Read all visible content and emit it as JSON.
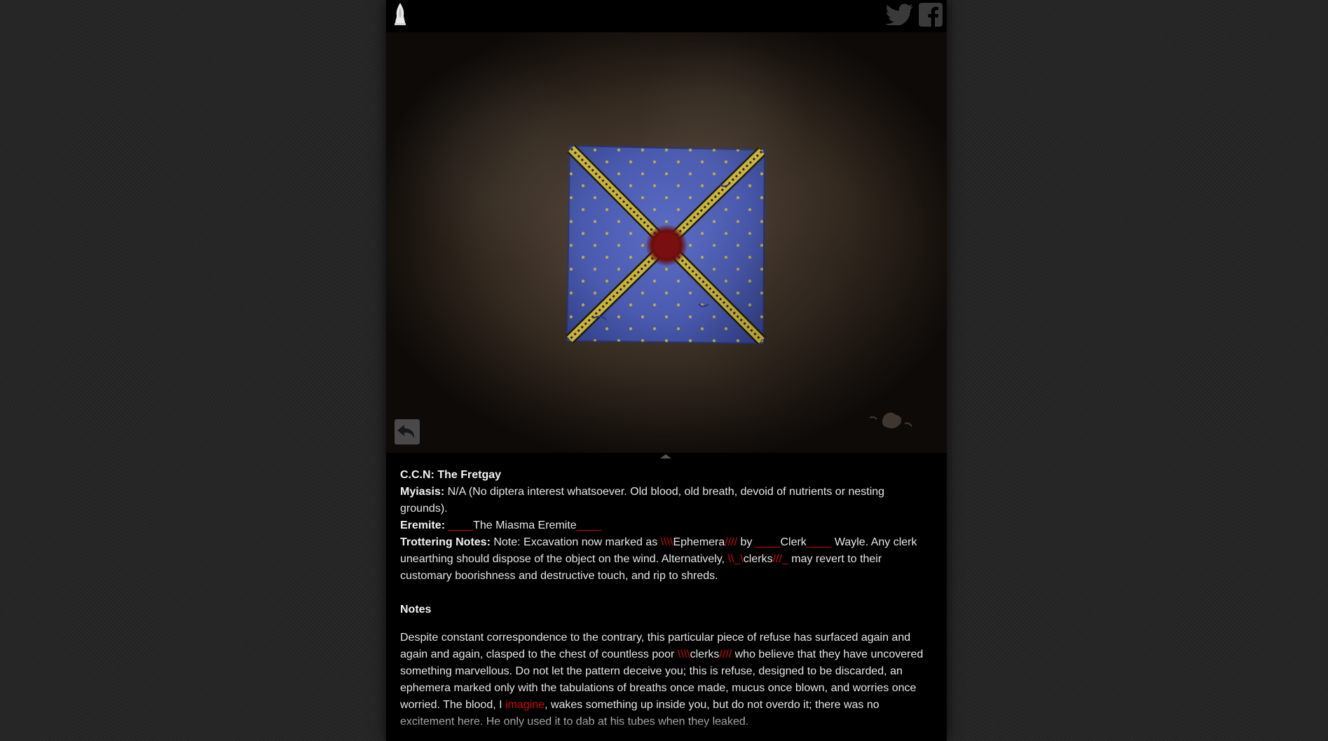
{
  "header": {
    "logo_icon": "candle-flame-icon",
    "social": [
      {
        "name": "twitter",
        "icon": "twitter-bird-icon"
      },
      {
        "name": "facebook",
        "icon": "facebook-f-icon"
      }
    ]
  },
  "viewer": {
    "artifact_icon": "blue-handkerchief-image",
    "back_icon": "undo-arrow-icon",
    "handle_icon": "collapse-caret-icon"
  },
  "entry": {
    "ccn_label": "C.C.N:",
    "ccn_value": "The Fretgay",
    "myiasis_label": "Myiasis:",
    "myiasis_value": " N/A (No diptera interest whatsoever. Old blood, old breath, devoid of nutrients or nesting grounds).",
    "eremite_label": "Eremite:",
    "eremite_pre": " ____",
    "eremite_value": "The Miasma Eremite",
    "eremite_post": "____",
    "trottering_label": "Trottering Notes:",
    "tn_1": " Note: Excavation now marked as ",
    "tn_red_1": "\\\\\\\\",
    "tn_2": "Ephemera",
    "tn_red_2": "////",
    "tn_3": " by ",
    "tn_red_3": "____",
    "tn_4": "Clerk",
    "tn_red_4": "____",
    "tn_5": " Wayle. Any clerk unearthing should dispose of the object on the wind. Alternatively, ",
    "tn_red_5": "\\\\_\\",
    "tn_6": "clerks",
    "tn_red_6": "///_",
    "tn_7": " may revert to their customary boorishness and destructive touch, and rip to shreds."
  },
  "notes": {
    "heading": "Notes",
    "p1": "Despite constant correspondence to the contrary, this particular piece of refuse has surfaced again and again and again, clasped to the chest of countless poor ",
    "red1": "\\\\\\\\",
    "p2": "clerks",
    "red2": "////",
    "p3": " who believe that they have uncovered something marvellous. Do not let the pattern deceive you; this is refuse, designed to be discarded, an ephemera marked only with the tabulations of breaths once made, mucus once blown, and worries once worried. The blood, I ",
    "red3": "imagine",
    "p4": ", wakes something up inside you, but do not overdo it; there was no excitement here. He only used it to dab at his tubes when they leaked."
  },
  "colors": {
    "accent_red": "#d10a0a",
    "text": "#e6e6e6",
    "panel": "#000000",
    "backdrop": "#242424"
  }
}
